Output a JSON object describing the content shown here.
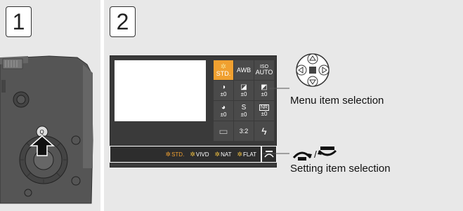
{
  "steps": {
    "step1_label": "1",
    "step2_label": "2"
  },
  "camera": {
    "q_button_label": "Q"
  },
  "quick_menu": {
    "cells": [
      {
        "icon": "STD.",
        "value": "",
        "active": true
      },
      {
        "icon": "AWB",
        "value": "",
        "active": false
      },
      {
        "icon": "ISO",
        "value": "AUTO",
        "active": false
      },
      {
        "icon": "◑",
        "value": "±0",
        "active": false
      },
      {
        "icon": "◪",
        "value": "±0",
        "active": false
      },
      {
        "icon": "◩",
        "value": "±0",
        "active": false
      },
      {
        "icon": "◕",
        "value": "±0",
        "active": false
      },
      {
        "icon": "S",
        "value": "±0",
        "active": false
      },
      {
        "icon": "NR",
        "value": "±0",
        "active": false
      },
      {
        "icon": "▭",
        "value": "",
        "active": false
      },
      {
        "icon": "3:2",
        "value": "",
        "active": false
      },
      {
        "icon": "ϟ",
        "value": "",
        "active": false
      }
    ]
  },
  "bottom_bar": {
    "options": [
      {
        "label": "STD.",
        "selected": true
      },
      {
        "label": "VIVD",
        "selected": false
      },
      {
        "label": "NAT",
        "selected": false
      },
      {
        "label": "FLAT",
        "selected": false
      }
    ]
  },
  "captions": {
    "menu": "Menu item selection",
    "setting": "Setting item selection"
  },
  "icons": {
    "cross_keys": "cross-keys-icon",
    "dials": "dial-icons",
    "separator": "/"
  },
  "colors": {
    "panel_bg": "#e8e8e8",
    "accent": "#f0a030",
    "lcd_bg": "#3a3a3a"
  }
}
